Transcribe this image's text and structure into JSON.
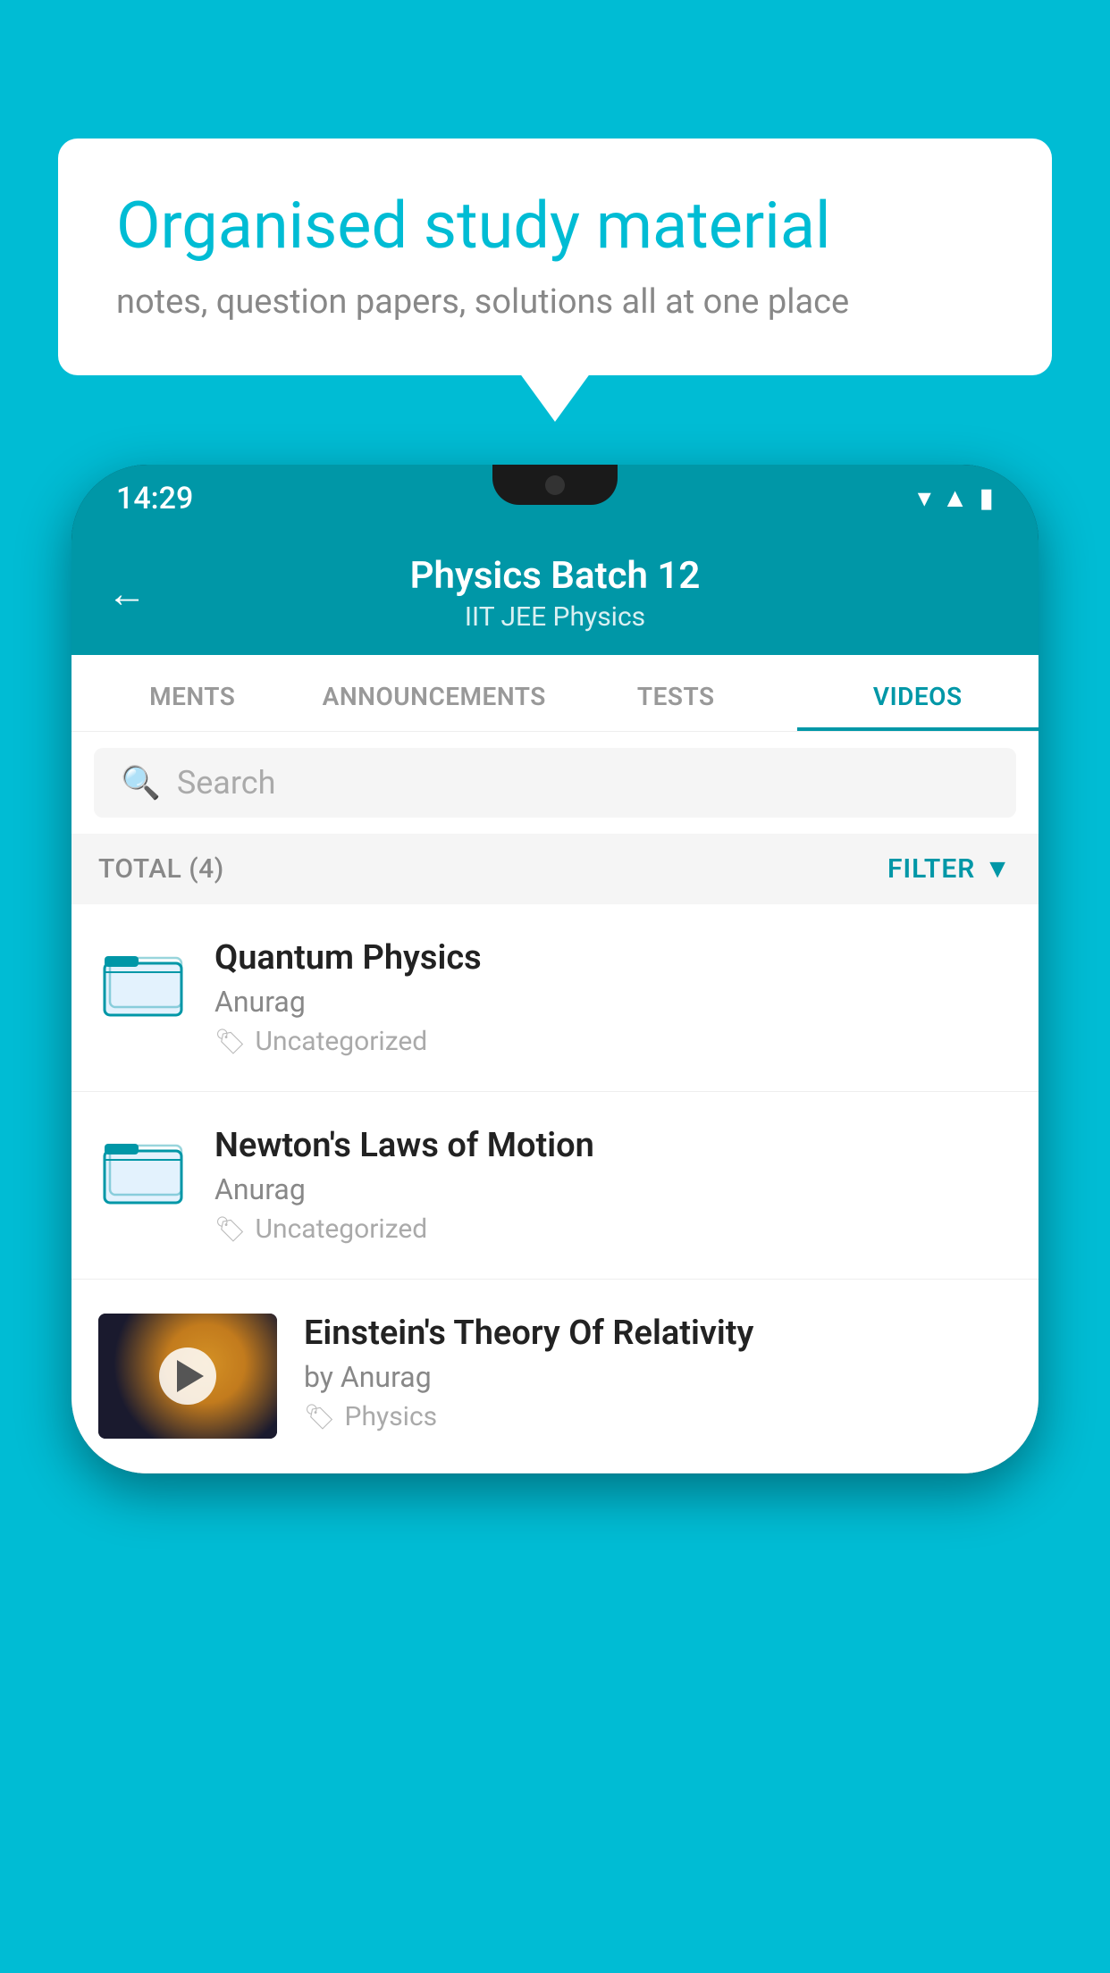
{
  "background_color": "#00BCD4",
  "bubble": {
    "title": "Organised study material",
    "subtitle": "notes, question papers, solutions all at one place"
  },
  "phone": {
    "status_bar": {
      "time": "14:29",
      "icons": [
        "wifi",
        "signal",
        "battery"
      ]
    },
    "header": {
      "back_label": "←",
      "title": "Physics Batch 12",
      "subtitle": "IIT JEE   Physics"
    },
    "tabs": [
      {
        "label": "MENTS",
        "active": false
      },
      {
        "label": "ANNOUNCEMENTS",
        "active": false
      },
      {
        "label": "TESTS",
        "active": false
      },
      {
        "label": "VIDEOS",
        "active": true
      }
    ],
    "search": {
      "placeholder": "Search"
    },
    "filter_bar": {
      "total_label": "TOTAL (4)",
      "filter_label": "FILTER"
    },
    "video_items": [
      {
        "title": "Quantum Physics",
        "author": "Anurag",
        "tag": "Uncategorized",
        "type": "folder"
      },
      {
        "title": "Newton's Laws of Motion",
        "author": "Anurag",
        "tag": "Uncategorized",
        "type": "folder"
      },
      {
        "title": "Einstein's Theory Of Relativity",
        "author": "by Anurag",
        "tag": "Physics",
        "type": "video"
      }
    ]
  }
}
